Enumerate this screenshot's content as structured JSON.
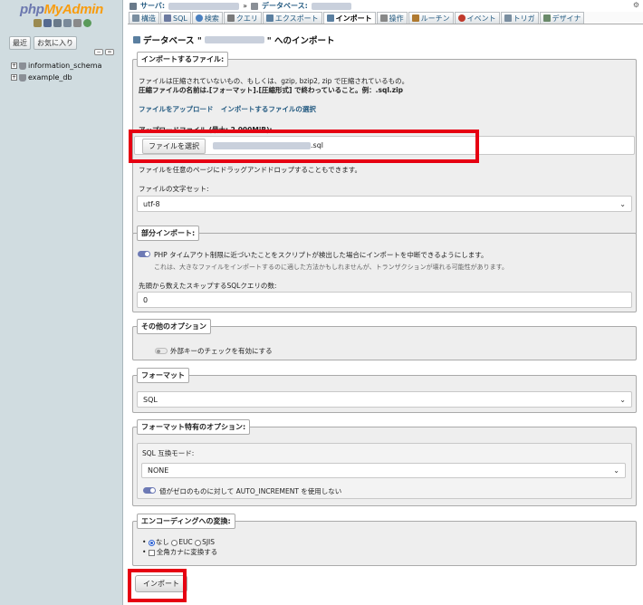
{
  "nav": {
    "logo_php": "php",
    "logo_myadmin": "MyAdmin",
    "tabs": [
      "最近",
      "お気に入り"
    ],
    "databases": [
      "information_schema",
      "example_db"
    ]
  },
  "topbar": {
    "server_label": "サーバ:",
    "database_label": "データベース:"
  },
  "menu": {
    "tabs": [
      {
        "label": "構造",
        "icon": "structure-icon",
        "color": "#7a8ea0"
      },
      {
        "label": "SQL",
        "icon": "sql-icon",
        "color": "#6c7aa0"
      },
      {
        "label": "検索",
        "icon": "search-icon",
        "color": "#4a80c0"
      },
      {
        "label": "クエリ",
        "icon": "query-icon",
        "color": "#7a7a7a"
      },
      {
        "label": "エクスポート",
        "icon": "export-icon",
        "color": "#5a7fa0"
      },
      {
        "label": "インポート",
        "icon": "import-icon",
        "color": "#5a7fa0",
        "active": true
      },
      {
        "label": "操作",
        "icon": "operations-icon",
        "color": "#888888"
      },
      {
        "label": "ルーチン",
        "icon": "routines-icon",
        "color": "#b07a30"
      },
      {
        "label": "イベント",
        "icon": "events-icon",
        "color": "#c0392b"
      },
      {
        "label": "トリガ",
        "icon": "triggers-icon",
        "color": "#7a8ea0"
      },
      {
        "label": "デザイナ",
        "icon": "designer-icon",
        "color": "#6a8a6a"
      }
    ]
  },
  "page": {
    "title_prefix": "データベース \"",
    "title_suffix": "\" へのインポート"
  },
  "import_file": {
    "legend": "インポートするファイル:",
    "desc1": "ファイルは圧縮されていないもの、もしくは、gzip, bzip2, zip で圧縮されているもの。",
    "desc2": "圧縮ファイルの名前は.[フォーマット].[圧縮形式] で終わっていること。例：.sql.zip",
    "link_upload": "ファイルをアップロード",
    "link_select": "インポートするファイルの選択",
    "upload_label": "アップロードファイル (最大: 2,000MiB):",
    "file_button": "ファイルを選択",
    "file_suffix": ".sql",
    "dragdrop_note": "ファイルを任意のページにドラッグアンドドロップすることもできます。",
    "charset_label": "ファイルの文字セット:",
    "charset_value": "utf-8"
  },
  "partial": {
    "legend": "部分インポート:",
    "timeout_label": "PHP タイムアウト制限に近づいたことをスクリプトが検出した場合にインポートを中断できるようにします。",
    "timeout_note": "これは、大きなファイルをインポートするのに適した方法かもしれませんが、トランザクションが壊れる可能性があります。",
    "skip_label": "先頭から数えたスキップするSQLクエリの数:",
    "skip_value": "0"
  },
  "other": {
    "legend": "その他のオプション",
    "fk_label": "外部キーのチェックを有効にする"
  },
  "format": {
    "legend": "フォーマット",
    "value": "SQL"
  },
  "format_specific": {
    "legend": "フォーマット特有のオプション:",
    "compat_label": "SQL 互換モード:",
    "compat_value": "NONE",
    "auto_inc_label": "値がゼロのものに対して AUTO_INCREMENT を使用しない"
  },
  "encoding": {
    "legend": "エンコーディングへの変換:",
    "opt_none": "なし",
    "opt_euc": "EUC",
    "opt_sjis": "SJIS",
    "kana_label": "全角カナに変換する"
  },
  "submit_label": "インポート",
  "highlight_color": "#e60012"
}
